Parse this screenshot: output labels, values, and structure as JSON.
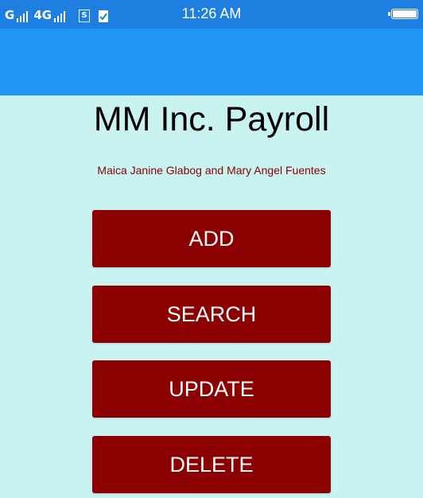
{
  "status_bar": {
    "signal_label_1": "G",
    "signal_label_2": "4G",
    "sim_label": "S",
    "time": "11:26 AM",
    "background": "#1e7fe0"
  },
  "app_bar": {
    "background": "#2196f3"
  },
  "main": {
    "title": "MM Inc. Payroll",
    "subtitle": "Maica Janine Glabog and Mary Angel Fuentes"
  },
  "buttons": {
    "add": "ADD",
    "search": "SEARCH",
    "update": "UPDATE",
    "delete": "DELETE"
  },
  "colors": {
    "page_background": "#c8f3f1",
    "button_background": "#8b0000",
    "subtitle_color": "#8b0000"
  },
  "icons": {
    "signal": "signal-bars-icon",
    "sim": "sim-card-icon",
    "clipboard": "clipboard-check-icon",
    "battery": "battery-icon"
  }
}
